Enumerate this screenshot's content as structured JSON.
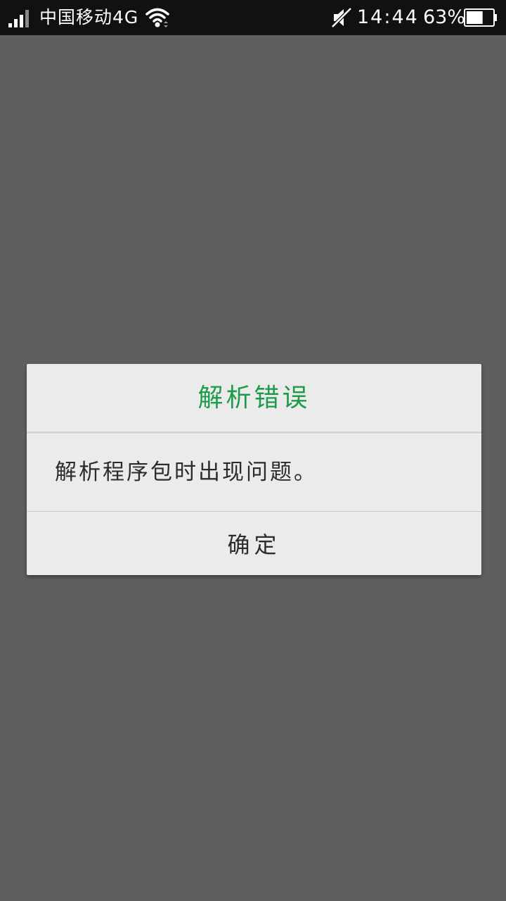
{
  "status_bar": {
    "carrier": "中国移动4G",
    "time": "14:44",
    "battery_percent": "63%",
    "battery_level": 0.63,
    "signal_bars": 4,
    "icons": [
      "signal-icon",
      "wifi-icon",
      "mute-icon",
      "battery-icon"
    ]
  },
  "dialog": {
    "title": "解析错误",
    "message": "解析程序包时出现问题。",
    "ok_label": "确定",
    "title_color": "#1e9a4b"
  }
}
